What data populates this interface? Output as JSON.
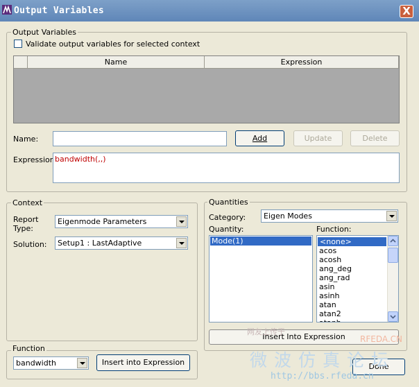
{
  "window": {
    "title": "Output Variables",
    "close_label": "X"
  },
  "output_variables": {
    "group_label": "Output Variables",
    "validate_label": "Validate output variables for selected context",
    "columns": [
      "Name",
      "Expression"
    ],
    "name_label": "Name:",
    "name_value": "",
    "expression_label": "Expression:",
    "expression_value": "bandwidth(,,)",
    "add_label": "Add",
    "update_label": "Update",
    "delete_label": "Delete"
  },
  "context": {
    "group_label": "Context",
    "report_type_label": "Report Type:",
    "report_type_value": "Eigenmode Parameters",
    "solution_label": "Solution:",
    "solution_value": "Setup1 : LastAdaptive"
  },
  "quantities": {
    "group_label": "Quantities",
    "category_label": "Category:",
    "category_value": "Eigen Modes",
    "quantity_label": "Quantity:",
    "function_label": "Function:",
    "quantity_items": [
      "Mode(1)"
    ],
    "function_items": [
      "<none>",
      "acos",
      "acosh",
      "ang_deg",
      "ang_rad",
      "asin",
      "asinh",
      "atan",
      "atan2",
      "atanh"
    ],
    "insert_label": "Insert Into Expression"
  },
  "function_group": {
    "group_label": "Function",
    "value": "bandwidth",
    "insert_label": "Insert into Expression"
  },
  "done_label": "Done",
  "watermark": {
    "line1": "微波仿真论坛",
    "url": "http://bbs.rfeda.cn",
    "brand": "RFEDA.CN",
    "small": "网友上传于"
  },
  "colors": {
    "expression_text": "#c00000",
    "selection": "#316ac5",
    "titlebar": "#6e93c0"
  }
}
